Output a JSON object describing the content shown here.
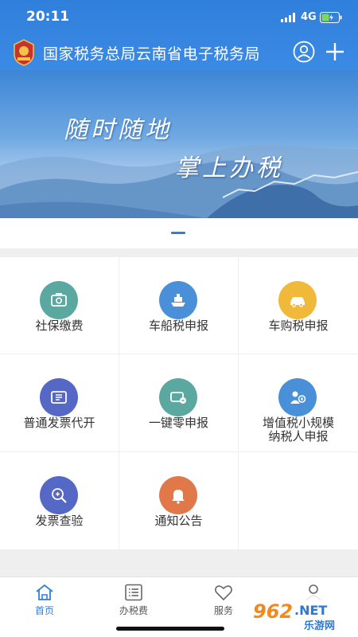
{
  "status_bar": {
    "time": "20:11",
    "network": "4G"
  },
  "nav": {
    "title": "国家税务总局云南省电子税务局"
  },
  "banner": {
    "line1": "随时随地",
    "line2": "掌上办税"
  },
  "services": [
    {
      "label": "社保缴费",
      "icon": "social-security-icon",
      "color": "#5ba8a0"
    },
    {
      "label": "车船税申报",
      "icon": "ship-icon",
      "color": "#4a90d9"
    },
    {
      "label": "车购税申报",
      "icon": "car-icon",
      "color": "#f0b93a"
    },
    {
      "label": "普通发票代开",
      "icon": "invoice-icon",
      "color": "#5568c6"
    },
    {
      "label": "一键零申报",
      "icon": "zero-declare-icon",
      "color": "#5ba8a0"
    },
    {
      "label": "增值税小规模纳税人申报",
      "label_line1": "增值税小规模",
      "label_line2": "纳税人申报",
      "icon": "taxpayer-icon",
      "color": "#4a90d9"
    },
    {
      "label": "发票查验",
      "icon": "invoice-check-icon",
      "color": "#5568c6"
    },
    {
      "label": "通知公告",
      "icon": "bell-icon",
      "color": "#e0784a"
    }
  ],
  "tabs": [
    {
      "label": "首页",
      "icon": "home-icon",
      "active": true
    },
    {
      "label": "办税费",
      "icon": "list-icon",
      "active": false
    },
    {
      "label": "服务",
      "icon": "heart-icon",
      "active": false
    },
    {
      "label": "我的",
      "icon": "profile-icon",
      "active": false
    }
  ],
  "watermark": {
    "text1": "962",
    "text2": ".NET",
    "text3": "乐游网"
  },
  "colors": {
    "primary": "#2f7fdc",
    "background": "#efefef"
  }
}
